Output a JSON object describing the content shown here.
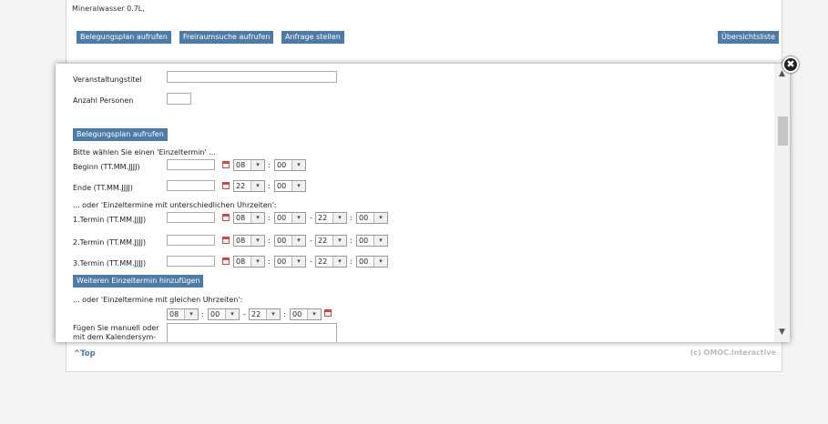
{
  "background": {
    "product_line": "Mineralwasser 0.7L,",
    "buttons": [
      "Belegungsplan aufrufen",
      "Freiraumsuche aufrufen",
      "Anfrage stellen"
    ],
    "list_button": "Übersichtsliste",
    "top_link": "^Top",
    "copyright": "(c) OMOC.interactive"
  },
  "modal": {
    "close_icon": "✖",
    "event_title_label": "Veranstaltungstitel",
    "persons_label": "Anzahl Personen",
    "plan_button": "Belegungsplan aufrufen",
    "single_prompt": "Bitte wählen Sie einen 'Einzeltermin' ...",
    "begin_label": "Beginn (TT.MM.JJJJ)",
    "end_label": "Ende (TT.MM.JJJJ)",
    "begin_hour": "08",
    "begin_min": "00",
    "end_hour": "22",
    "end_min": "00",
    "diff_prompt": "... oder 'Einzeltermine mit unterschiedlichen Uhrzeiten':",
    "terms": [
      {
        "label": "1.Termin (TT.MM.JJJJ)",
        "h1": "08",
        "m1": "00",
        "h2": "22",
        "m2": "00"
      },
      {
        "label": "2.Termin (TT.MM.JJJJ)",
        "h1": "08",
        "m1": "00",
        "h2": "22",
        "m2": "00"
      },
      {
        "label": "3.Termin (TT.MM.JJJJ)",
        "h1": "08",
        "m1": "00",
        "h2": "22",
        "m2": "00"
      }
    ],
    "dash": "-",
    "colon": ":",
    "add_button": "Weiteren Einzeltermin hinzufügen",
    "same_prompt": "... oder 'Einzeltermine mit gleichen Uhrzeiten':",
    "same_h1": "08",
    "same_m1": "00",
    "same_h2": "22",
    "same_m2": "00",
    "manual_label_1": "Fügen Sie manuell oder",
    "manual_label_2": "mit dem Kalendersym-"
  }
}
